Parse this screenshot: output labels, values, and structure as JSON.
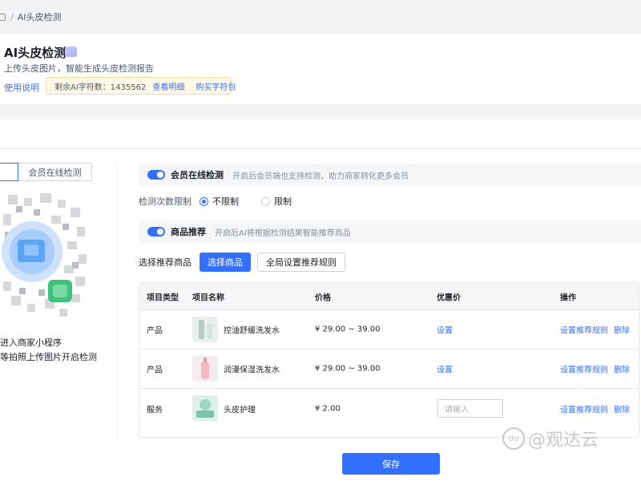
{
  "breadcrumb": {
    "separator": "/",
    "current": "AI头皮检测"
  },
  "header": {
    "title": "AI头皮检测",
    "subtitle": "上传头皮图片，智能生成头皮检测报告",
    "help_link": "使用说明",
    "quota_label": "剩余AI字符数：1435562",
    "quota_view_link": "查看明细",
    "quota_buy_link": "购买字符包"
  },
  "left_panel": {
    "tab_label": "会员在线检测",
    "hint_line1": "进入商家小程序",
    "hint_line2": "等拍照上传图片开启检测"
  },
  "member_detect": {
    "label": "会员在线检测",
    "enabled": true,
    "description": "开启后会员端也支持检测，助力商家转化更多会员"
  },
  "limit": {
    "label": "检测次数限制",
    "options": [
      {
        "label": "不限制",
        "selected": true
      },
      {
        "label": "限制",
        "selected": false
      }
    ]
  },
  "recommend": {
    "label": "商品推荐",
    "enabled": true,
    "description": "开启后AI将根据检测结果智能推荐商品"
  },
  "picker": {
    "label": "选择推荐商品",
    "select_button": "选择商品",
    "rule_button": "全局设置推荐规则"
  },
  "table": {
    "headers": [
      "项目类型",
      "项目名称",
      "价格",
      "优惠价",
      "操作"
    ],
    "rows": [
      {
        "type": "产品",
        "name": "控油舒缓洗发水",
        "price": "¥ 29.00 ~ 39.00",
        "discount": "设置",
        "op_rule": "设置推荐规则",
        "op_delete": "删除",
        "thumb": "bottle-tube"
      },
      {
        "type": "产品",
        "name": "润漫保湿洗发水",
        "price": "¥ 29.00 ~ 39.00",
        "discount": "设置",
        "op_rule": "设置推荐规则",
        "op_delete": "删除",
        "thumb": "pink-bottle"
      },
      {
        "type": "服务",
        "name": "头皮护理",
        "price": "¥ 2.00",
        "discount_placeholder": "请输入",
        "op_rule": "设置推荐规则",
        "op_delete": "删除",
        "thumb": "spa-scene"
      }
    ]
  },
  "footer": {
    "save_button": "保存"
  },
  "watermark": {
    "text": "@观达云",
    "icon": "du"
  },
  "colors": {
    "accent": "#3370ff",
    "quota_bg": "#fff8e6",
    "table_header_bg": "#f5f6f7"
  }
}
